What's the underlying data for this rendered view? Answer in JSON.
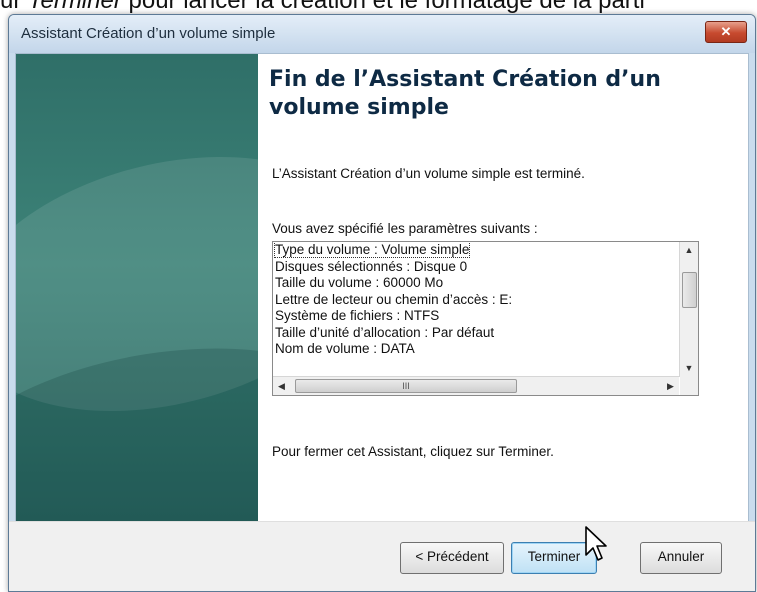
{
  "background_caption": {
    "prefix": "ur ",
    "emphasis": "Terminer",
    "suffix": " pour lancer la création et le formatage de la parti"
  },
  "window": {
    "title": "Assistant Création d’un volume simple",
    "close_symbol": "✕"
  },
  "wizard": {
    "heading": "Fin de l’Assistant Création d’un volume simple",
    "completed_text": "L’Assistant Création d’un volume simple est terminé.",
    "params_label": "Vous avez spécifié les paramètres suivants :",
    "params": [
      "Type du volume : Volume simple",
      "Disques sélectionnés : Disque 0",
      "Taille du volume : 60000 Mo",
      "Lettre de lecteur ou chemin d’accès : E:",
      "Système de fichiers : NTFS",
      "Taille d’unité d’allocation : Par défaut",
      "Nom de volume : DATA"
    ],
    "scroll_grip": "III",
    "close_instruction": "Pour fermer cet Assistant, cliquez sur Terminer."
  },
  "buttons": {
    "back": "< Précédent",
    "finish": "Terminer",
    "cancel": "Annuler"
  },
  "colors": {
    "side_panel": "#2f6f68",
    "title_blue": "#0e2a44",
    "close_red": "#c74a2f"
  },
  "icons": {
    "close": "close-icon",
    "cursor": "mouse-pointer-icon"
  }
}
